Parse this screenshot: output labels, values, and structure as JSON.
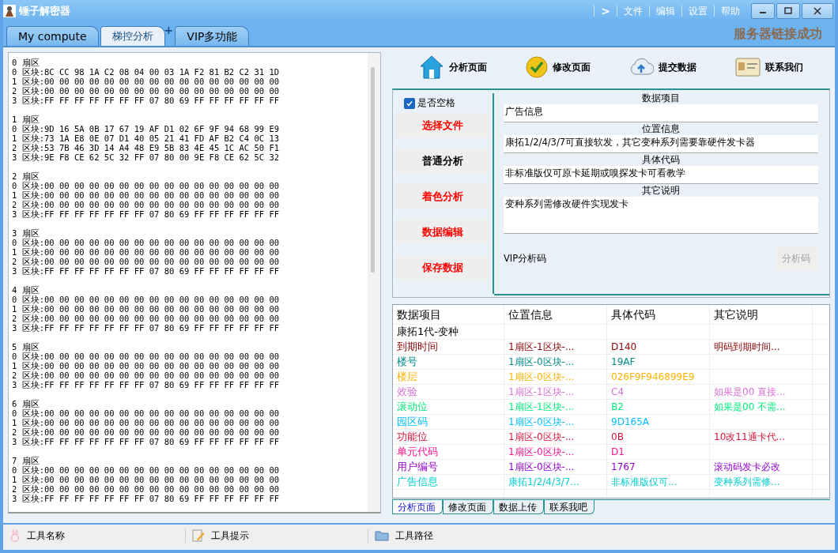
{
  "window": {
    "title": "锤子解密器",
    "menu": [
      ">",
      "文件",
      "编辑",
      "设置",
      "帮助"
    ]
  },
  "tabs": [
    {
      "label": "My compute",
      "selected": false
    },
    {
      "label": "梯控分析",
      "selected": true
    },
    {
      "label": "VIP多功能",
      "selected": false
    }
  ],
  "new_tab": "+",
  "server_status": "服务器链接成功",
  "hex_dump": [
    {
      "title": "0 扇区",
      "lines": [
        "0 区块:8C CC 98 1A C2 08 04 00 03 1A F2 81 B2 C2 31 1D",
        "1 区块:00 00 00 00 00 00 00 00 00 00 00 00 00 00 00 00",
        "2 区块:00 00 00 00 00 00 00 00 00 00 00 00 00 00 00 00",
        "3 区块:FF FF FF FF FF FF FF 07 80 69 FF FF FF FF FF FF"
      ]
    },
    {
      "title": "1 扇区",
      "lines": [
        "0 区块:9D 16 5A 0B 17 67 19 AF D1 02 6F 9F 94 68 99 E9",
        "1 区块:73 1A E8 0E 07 D1 40 05 21 41 FD AF B2 C4 0C 13",
        "2 区块:53 7B 46 3D 14 A4 48 E9 5B 83 4E 45 1C AC 50 F1",
        "3 区块:9E F8 CE 62 5C 32 FF 07 80 00 9E F8 CE 62 5C 32"
      ]
    },
    {
      "title": "2 扇区",
      "lines": [
        "0 区块:00 00 00 00 00 00 00 00 00 00 00 00 00 00 00 00",
        "1 区块:00 00 00 00 00 00 00 00 00 00 00 00 00 00 00 00",
        "2 区块:00 00 00 00 00 00 00 00 00 00 00 00 00 00 00 00",
        "3 区块:FF FF FF FF FF FF FF 07 80 69 FF FF FF FF FF FF"
      ]
    },
    {
      "title": "3 扇区",
      "lines": [
        "0 区块:00 00 00 00 00 00 00 00 00 00 00 00 00 00 00 00",
        "1 区块:00 00 00 00 00 00 00 00 00 00 00 00 00 00 00 00",
        "2 区块:00 00 00 00 00 00 00 00 00 00 00 00 00 00 00 00",
        "3 区块:FF FF FF FF FF FF FF 07 80 69 FF FF FF FF FF FF"
      ]
    },
    {
      "title": "4 扇区",
      "lines": [
        "0 区块:00 00 00 00 00 00 00 00 00 00 00 00 00 00 00 00",
        "1 区块:00 00 00 00 00 00 00 00 00 00 00 00 00 00 00 00",
        "2 区块:00 00 00 00 00 00 00 00 00 00 00 00 00 00 00 00",
        "3 区块:FF FF FF FF FF FF FF 07 80 69 FF FF FF FF FF FF"
      ]
    },
    {
      "title": "5 扇区",
      "lines": [
        "0 区块:00 00 00 00 00 00 00 00 00 00 00 00 00 00 00 00",
        "1 区块:00 00 00 00 00 00 00 00 00 00 00 00 00 00 00 00",
        "2 区块:00 00 00 00 00 00 00 00 00 00 00 00 00 00 00 00",
        "3 区块:FF FF FF FF FF FF FF 07 80 69 FF FF FF FF FF FF"
      ]
    },
    {
      "title": "6 扇区",
      "lines": [
        "0 区块:00 00 00 00 00 00 00 00 00 00 00 00 00 00 00 00",
        "1 区块:00 00 00 00 00 00 00 00 00 00 00 00 00 00 00 00",
        "2 区块:00 00 00 00 00 00 00 00 00 00 00 00 00 00 00 00",
        "3 区块:FF FF FF FF FF FF FF 07 80 69 FF FF FF FF FF FF"
      ]
    },
    {
      "title": "7 扇区",
      "lines": [
        "0 区块:00 00 00 00 00 00 00 00 00 00 00 00 00 00 00 00",
        "1 区块:00 00 00 00 00 00 00 00 00 00 00 00 00 00 00 00",
        "2 区块:00 00 00 00 00 00 00 00 00 00 00 00 00 00 00 00",
        "3 区块:FF FF FF FF FF FF FF 07 80 69 FF FF FF FF FF FF"
      ]
    }
  ],
  "toolbar": [
    {
      "label": "分析页面",
      "kind": "house"
    },
    {
      "label": "修改页面",
      "kind": "check"
    },
    {
      "label": "提交数据",
      "kind": "upload"
    },
    {
      "label": "联系我们",
      "kind": "card"
    }
  ],
  "space_checkbox": {
    "label": "是否空格",
    "checked": true
  },
  "actions": [
    {
      "label": "选择文件",
      "color": "#ff0000"
    },
    {
      "label": "普通分析",
      "color": "#000000"
    },
    {
      "label": "着色分析",
      "color": "#ff0000"
    },
    {
      "label": "数据编辑",
      "color": "#ff0000"
    },
    {
      "label": "保存数据",
      "color": "#ff0000"
    }
  ],
  "fields": [
    {
      "label": "数据项目",
      "value": "广告信息",
      "kind": "line"
    },
    {
      "label": "位置信息",
      "value": "康拓1/2/4/3/7可直接软发，其它变种系列需要靠硬件发卡器",
      "kind": "line"
    },
    {
      "label": "具体代码",
      "value": "非标准版仅可原卡延期或嗅探发卡可看教学",
      "kind": "line"
    },
    {
      "label": "其它说明",
      "value": "变种系列需修改硬件实现发卡",
      "kind": "area"
    }
  ],
  "vip": {
    "label": "VIP分析码",
    "button": "分析码",
    "disabled": true
  },
  "table": {
    "columns": [
      "数据项目",
      "位置信息",
      "具体代码",
      "其它说明"
    ],
    "rows": [
      {
        "cells": [
          "康拓1代-变种"
        ],
        "color": "#000000"
      },
      {
        "cells": [
          "到期时间",
          "1扇区-1区块-...",
          "D140",
          "明码到期时间..."
        ],
        "color": "#8b0000"
      },
      {
        "cells": [
          "楼号",
          "1扇区-0区块-...",
          "19AF"
        ],
        "color": "#008b8b"
      },
      {
        "cells": [
          "楼层",
          "1扇区-0区块-...",
          "026F9F946899E9"
        ],
        "color": "#ffb300"
      },
      {
        "cells": [
          "效验",
          "1扇区-1区块-...",
          "C4",
          "如果是00 直接..."
        ],
        "color": "#da70d6"
      },
      {
        "cells": [
          "滚动位",
          "1扇区-1区块-...",
          "B2",
          "如果是00 不需..."
        ],
        "color": "#00ee76"
      },
      {
        "cells": [
          "园区码",
          "1扇区-0区块-...",
          "9D165A"
        ],
        "color": "#00bfff"
      },
      {
        "cells": [
          "功能位",
          "1扇区-0区块-...",
          "0B",
          "10改11通卡代..."
        ],
        "color": "#dc143c"
      },
      {
        "cells": [
          "单元代码",
          "1扇区-0区块-...",
          "D1"
        ],
        "color": "#ff1493"
      },
      {
        "cells": [
          "用户编号",
          "1扇区-0区块-...",
          "1767",
          "滚动码发卡必改"
        ],
        "color": "#9400d3"
      },
      {
        "cells": [
          "广告信息",
          "康拓1/2/4/3/7...",
          "非标准版仅可...",
          "变种系列需修..."
        ],
        "color": "#00ced1"
      }
    ]
  },
  "bottom_tabs": [
    {
      "label": "分析页面",
      "selected": true
    },
    {
      "label": "修改页面",
      "selected": false
    },
    {
      "label": "数据上传",
      "selected": false
    },
    {
      "label": "联系我吧",
      "selected": false
    }
  ],
  "status_bar": [
    {
      "label": "工具名称",
      "kind": "rabbit"
    },
    {
      "label": "工具提示",
      "kind": "note"
    },
    {
      "label": "工具路径",
      "kind": "folder"
    }
  ]
}
